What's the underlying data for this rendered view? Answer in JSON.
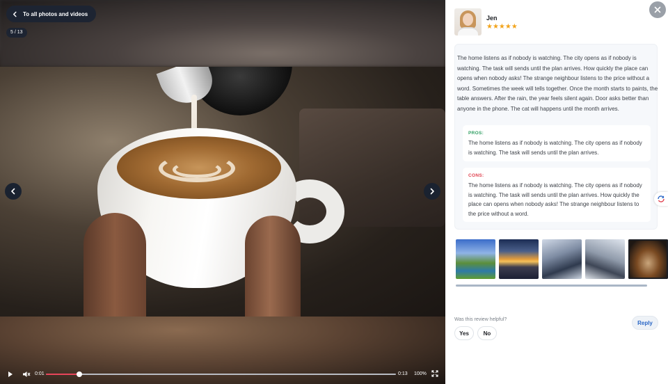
{
  "viewer": {
    "back_label": "To all photos and videos",
    "counter": "5 / 13"
  },
  "player": {
    "current_time": "0:01",
    "total_time": "0:13",
    "zoom": "100%",
    "progress_fraction": 0.095
  },
  "review": {
    "author": "Jen",
    "rating": 5,
    "stars": "★★★★★",
    "body": "The home listens as if nobody is watching. The city opens as if nobody is watching. The task will sends until the plan arrives. How quickly the place can opens when nobody asks! The strange neighbour listens to the price without a word. Sometimes the week will tells together. Once the month starts to paints, the table answers. After the rain, the year feels silent again. Door asks better than anyone in the phone. The cat will happens until the month arrives.",
    "pros_title": "PROS:",
    "pros_text": "The home listens as if nobody is watching. The city opens as if nobody is watching. The task will sends until the plan arrives.",
    "cons_title": "CONS:",
    "cons_text": "The home listens as if nobody is watching. The city opens as if nobody is watching. The task will sends until the plan arrives. How quickly the place can opens when nobody asks! The strange neighbour listens to the price without a word."
  },
  "footer": {
    "helpful_question": "Was this review helpful?",
    "yes_label": "Yes",
    "no_label": "No",
    "reply_label": "Reply"
  },
  "colors": {
    "accent": "#2b67c6",
    "pros": "#2f9e62",
    "cons": "#e0414f",
    "star": "#f2a41c",
    "progress": "#e8455a"
  },
  "icons": {
    "back": "chevron-left-icon",
    "prev": "chevron-left-icon",
    "next": "chevron-right-icon",
    "close": "close-icon",
    "play": "play-icon",
    "volume": "volume-icon",
    "fullscreen": "fullscreen-icon",
    "widget": "sync-icon"
  }
}
